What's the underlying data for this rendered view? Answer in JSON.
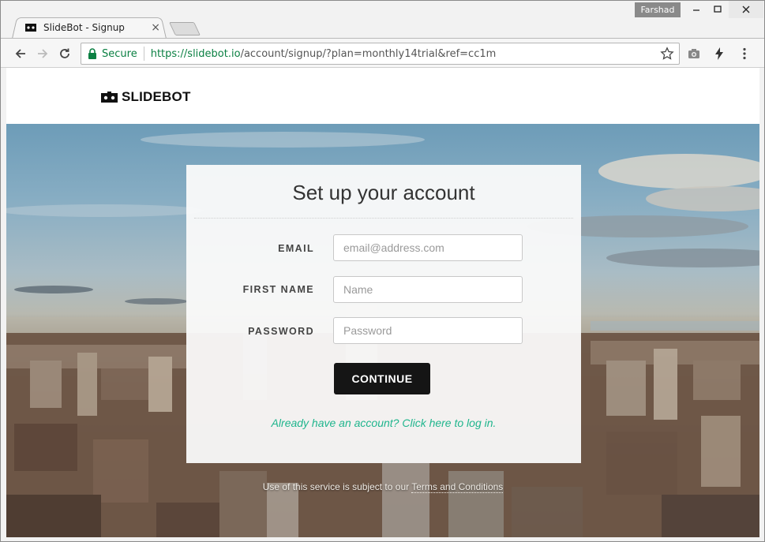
{
  "browser": {
    "tab_title": "SlideBot - Signup",
    "tab_close": "×",
    "user_name": "Farshad",
    "secure_label": "Secure",
    "url_scheme_host": "https://slidebot.io",
    "url_path": "/account/signup/?plan=monthly14trial&ref=cc1m"
  },
  "site": {
    "logo_text": "SLIDEBOT"
  },
  "form": {
    "title": "Set up your account",
    "email_label": "EMAIL",
    "email_placeholder": "email@address.com",
    "first_name_label": "FIRST NAME",
    "first_name_placeholder": "Name",
    "password_label": "PASSWORD",
    "password_placeholder": "Password",
    "continue_label": "CONTINUE",
    "login_link": "Already have an account? Click here to log in."
  },
  "footer": {
    "terms_prefix": "Use of this service is subject to our ",
    "terms_link": "Terms and Conditions"
  },
  "colors": {
    "accent": "#1fb58d",
    "button": "#151515",
    "secure": "#0b8043"
  }
}
